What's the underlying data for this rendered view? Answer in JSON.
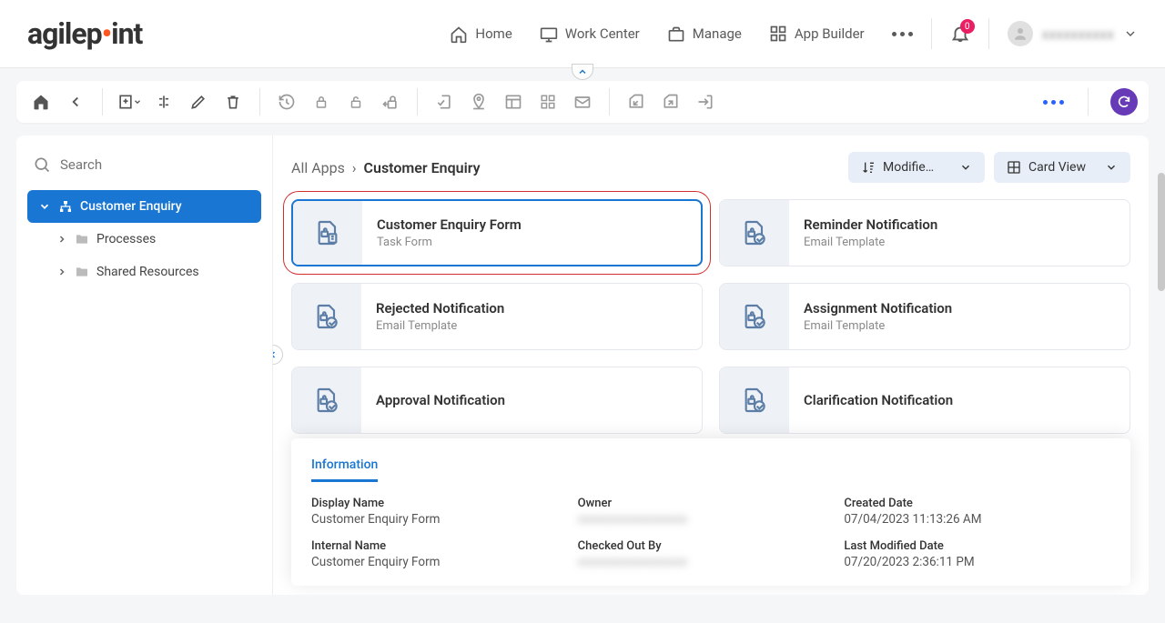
{
  "nav": {
    "home": "Home",
    "workcenter": "Work Center",
    "manage": "Manage",
    "appbuilder": "App Builder",
    "badge": "0",
    "username": "xxxxxxxxxx"
  },
  "search": {
    "placeholder": "Search"
  },
  "tree": {
    "root": "Customer Enquiry",
    "processes": "Processes",
    "shared": "Shared Resources"
  },
  "crumb": {
    "root": "All Apps",
    "current": "Customer Enquiry"
  },
  "controls": {
    "sort": "Modifie…",
    "view": "Card View"
  },
  "cards": [
    {
      "title": "Customer Enquiry Form",
      "sub": "Task Form",
      "kind": "form",
      "sel": true
    },
    {
      "title": "Reminder Notification",
      "sub": "Email Template",
      "kind": "email"
    },
    {
      "title": "Rejected Notification",
      "sub": "Email Template",
      "kind": "email"
    },
    {
      "title": "Assignment Notification",
      "sub": "Email Template",
      "kind": "email"
    },
    {
      "title": "Approval Notification",
      "sub": "",
      "kind": "email"
    },
    {
      "title": "Clarification Notification",
      "sub": "",
      "kind": "email"
    }
  ],
  "info": {
    "tab": "Information",
    "display_name_lbl": "Display Name",
    "display_name": "Customer Enquiry Form",
    "owner_lbl": "Owner",
    "owner": "xxxxxxxxxxxxxxxxxx",
    "created_lbl": "Created Date",
    "created": "07/04/2023 11:13:26 AM",
    "internal_lbl": "Internal Name",
    "internal": "Customer Enquiry Form",
    "checked_lbl": "Checked Out By",
    "checked": "xxxxxxxxxxxxxxxxxx",
    "modified_lbl": "Last Modified Date",
    "modified": "07/20/2023 2:36:11 PM"
  }
}
